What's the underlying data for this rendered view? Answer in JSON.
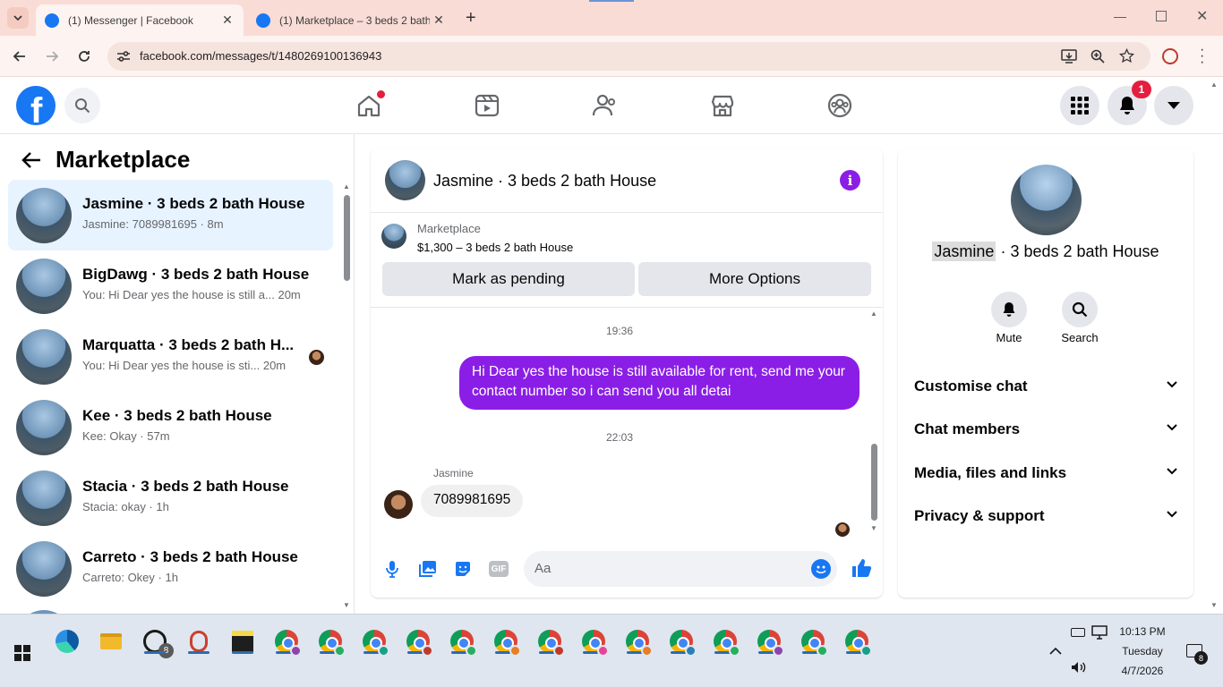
{
  "browser": {
    "tabs": [
      {
        "title": "(1) Messenger | Facebook"
      },
      {
        "title": "(1) Marketplace – 3 beds 2 bath"
      }
    ],
    "url": "facebook.com/messages/t/1480269100136943"
  },
  "nav": {
    "notification_count": "1"
  },
  "sidebar": {
    "title": "Marketplace",
    "conversations": [
      {
        "name": "Jasmine · 3 beds 2 bath House",
        "preview": "Jasmine: 7089981695 · 8m"
      },
      {
        "name": "BigDawg · 3 beds 2 bath House",
        "preview": "You: Hi Dear yes the house is still a...  20m"
      },
      {
        "name": "Marquatta · 3 beds 2 bath H...",
        "preview": "You: Hi Dear yes the house is sti...  20m"
      },
      {
        "name": "Kee · 3 beds 2 bath House",
        "preview": "Kee: Okay · 57m"
      },
      {
        "name": "Stacia · 3 beds 2 bath House",
        "preview": "Stacia: okay · 1h"
      },
      {
        "name": "Carreto · 3 beds 2 bath House",
        "preview": "Carreto: Okey · 1h"
      }
    ]
  },
  "chat": {
    "header_title": "Jasmine · 3 beds 2 bath House",
    "listing": {
      "source": "Marketplace",
      "price_title": "$1,300 – 3 beds 2 bath House"
    },
    "mark_pending_label": "Mark as pending",
    "more_options_label": "More Options",
    "messages": [
      {
        "time": "19:36",
        "text": "Hi Dear yes the house is still available for rent, send me your contact number so i can send you all detai"
      },
      {
        "time": "22:03",
        "sender": "Jasmine",
        "text": "7089981695"
      }
    ],
    "composer_placeholder": "Aa"
  },
  "details": {
    "name_highlight": "Jasmine",
    "name_rest": " · 3 beds 2 bath House",
    "mute_label": "Mute",
    "search_label": "Search",
    "sections": [
      "Customise chat",
      "Chat members",
      "Media, files and links",
      "Privacy & support"
    ]
  },
  "taskbar": {
    "whatsapp_badge": "8",
    "time": "10:13 PM",
    "day": "Tuesday",
    "date": "4/7/2026",
    "notif_badge": "8"
  },
  "colors": {
    "fb_blue": "#1877f2",
    "messenger_purple": "#8a1ee6",
    "bubble_grey": "#f0f0f0",
    "selected_bg": "#e7f3ff"
  }
}
